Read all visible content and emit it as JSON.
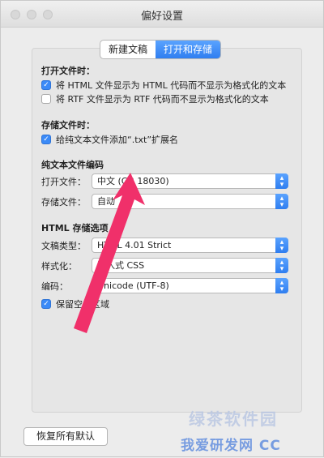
{
  "window": {
    "title": "偏好设置"
  },
  "tabs": {
    "new_doc": "新建文稿",
    "open_save": "打开和存储"
  },
  "open_files": {
    "header": "打开文件时：",
    "html_option": "将 HTML 文件显示为 HTML 代码而不显示为格式化的文本",
    "html_checked": true,
    "rtf_option": "将 RTF 文件显示为 RTF 代码而不显示为格式化的文本",
    "rtf_checked": false
  },
  "save_files": {
    "header": "存储文件时：",
    "txt_option": "给纯文本文件添加“.txt”扩展名",
    "txt_checked": true
  },
  "plain_text": {
    "header": "纯文本文件编码",
    "open_label": "打开文件：",
    "open_value": "中文 (GB 18030)",
    "save_label": "存储文件：",
    "save_value": "自动"
  },
  "html_options": {
    "header": "HTML 存储选项",
    "doc_type_label": "文稿类型：",
    "doc_type_value": "HTML 4.01 Strict",
    "styling_label": "样式化：",
    "styling_value": "嵌入式 CSS",
    "encoding_label": "编码：",
    "encoding_value": "Unicode (UTF-8)",
    "preserve_option": "保留空白区域",
    "preserve_checked": true
  },
  "restore_button": "恢复所有默认",
  "watermark": {
    "line1": "绿茶软件园",
    "line2": "我爱研发网 CC"
  },
  "colors": {
    "accent": "#3b8af7",
    "annotation_arrow": "#f0306a"
  }
}
